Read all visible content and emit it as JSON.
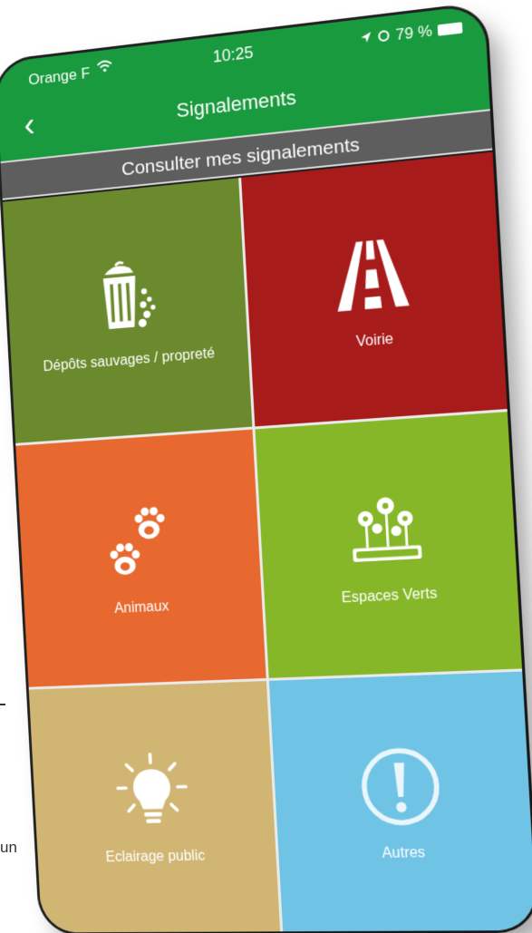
{
  "background": {
    "fragment_text": "un"
  },
  "statusbar": {
    "carrier": "Orange F",
    "time": "10:25",
    "battery": "79 %"
  },
  "navbar": {
    "back_icon": "chevron-left",
    "title": "Signalements"
  },
  "subheader": {
    "label": "Consulter mes signalements"
  },
  "tiles": [
    {
      "label": "Dépôts sauvages / propreté",
      "icon": "trash-icon",
      "color": "#6a8a2d"
    },
    {
      "label": "Voirie",
      "icon": "road-icon",
      "color": "#a71b1b"
    },
    {
      "label": "Animaux",
      "icon": "paw-icon",
      "color": "#e8692f"
    },
    {
      "label": "Espaces Verts",
      "icon": "flowers-icon",
      "color": "#86b728"
    },
    {
      "label": "Eclairage public",
      "icon": "lightbulb-icon",
      "color": "#d1b673"
    },
    {
      "label": "Autres",
      "icon": "exclamation-icon",
      "color": "#6fc3e5"
    }
  ],
  "colors": {
    "header_green": "#1a9a3e",
    "subheader_gray": "#5e5e5e"
  }
}
